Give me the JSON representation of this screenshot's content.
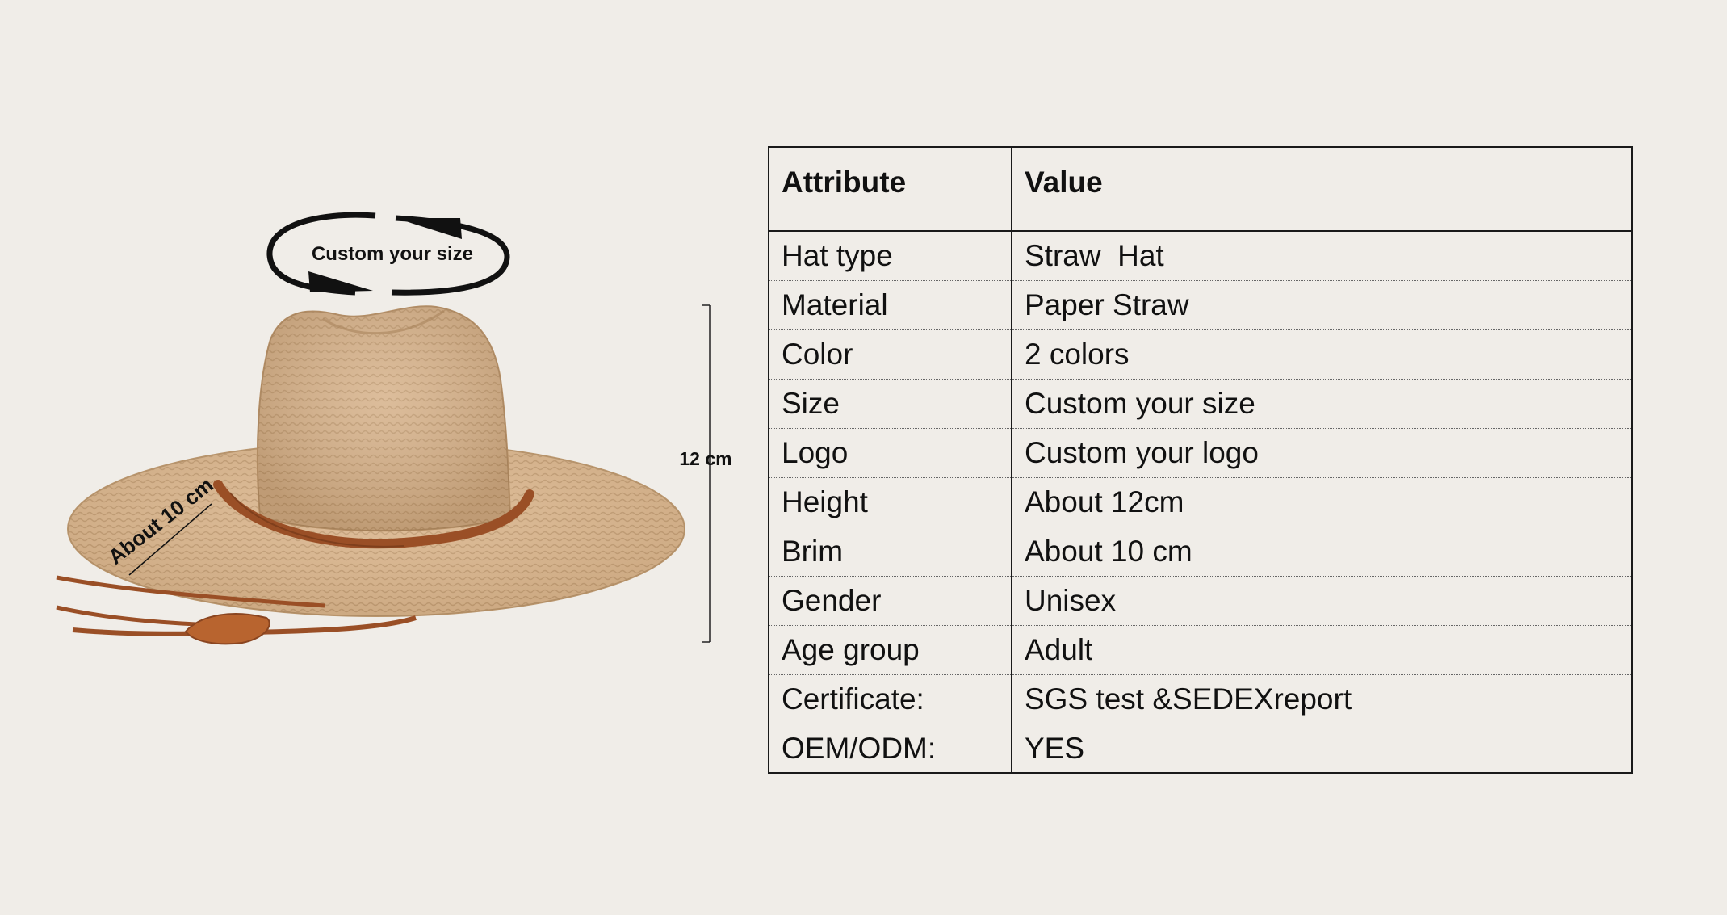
{
  "figure": {
    "size_ring_label": "Custom your size",
    "height_label": "12 cm",
    "brim_label": "About  10 cm"
  },
  "table": {
    "headers": {
      "attribute": "Attribute",
      "value": "Value"
    },
    "rows": [
      {
        "attribute": "Hat type",
        "value": "Straw  Hat"
      },
      {
        "attribute": "Material",
        "value": "Paper Straw"
      },
      {
        "attribute": "Color",
        "value": "2 colors"
      },
      {
        "attribute": "Size",
        "value": "Custom your size"
      },
      {
        "attribute": "Logo",
        "value": "Custom your logo"
      },
      {
        "attribute": "Height",
        "value": "About 12cm"
      },
      {
        "attribute": "Brim",
        "value": "About 10 cm"
      },
      {
        "attribute": "Gender",
        "value": "Unisex"
      },
      {
        "attribute": "Age group",
        "value": "Adult"
      },
      {
        "attribute": "Certificate:",
        "value": "SGS test &SEDEXreport"
      },
      {
        "attribute": "OEM/ODM:",
        "value": "YES"
      }
    ]
  },
  "colors": {
    "background": "#f0ede8",
    "straw": "#d8b48a",
    "leather_band": "#9a4f26"
  }
}
